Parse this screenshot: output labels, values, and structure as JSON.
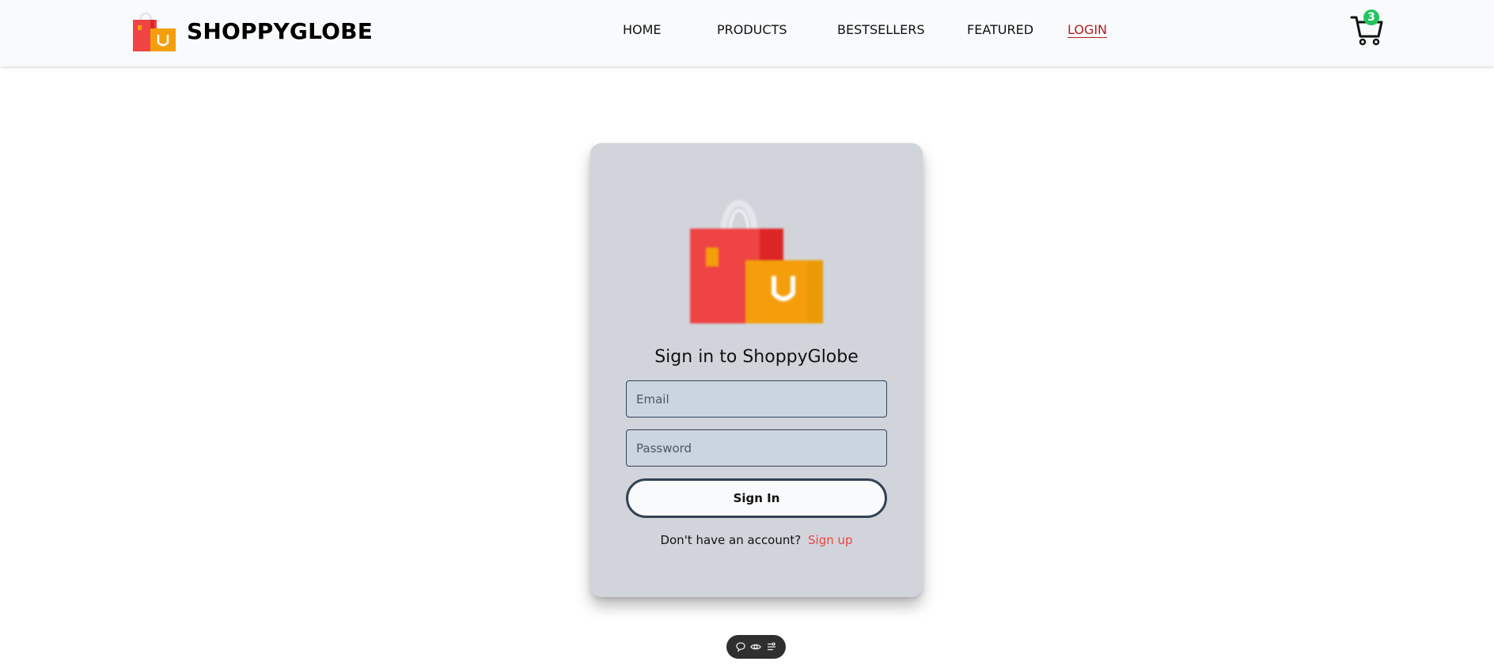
{
  "brand": {
    "name": "SHOPPYGLOBE",
    "logo_icon": "shopping-bags-icon"
  },
  "nav": {
    "items": [
      {
        "label": "HOME",
        "active": false
      },
      {
        "label": "PRODUCTS",
        "active": false
      },
      {
        "label": "BESTSELLERS",
        "active": false
      },
      {
        "label": "FEATURED",
        "active": false
      },
      {
        "label": "LOGIN",
        "active": true
      }
    ],
    "active_color": "#b91c1c"
  },
  "cart": {
    "icon": "cart-icon",
    "count": "3",
    "badge_color": "#22c55e"
  },
  "login": {
    "title": "Sign in to ShoppyGlobe",
    "email": {
      "value": "",
      "placeholder": "Email"
    },
    "password": {
      "value": "",
      "placeholder": "Password"
    },
    "submit_label": "Sign In",
    "signup_prompt": "Don't have an account?",
    "signup_link": "Sign up",
    "signup_color": "#ef4444"
  },
  "toolbar": {
    "icons": [
      "comment-icon",
      "eye-icon",
      "settings-sliders-icon"
    ]
  },
  "colors": {
    "card_bg": "#d1d5db",
    "field_bg": "#cbd5e1",
    "navbar_bg": "#f8fafc"
  }
}
